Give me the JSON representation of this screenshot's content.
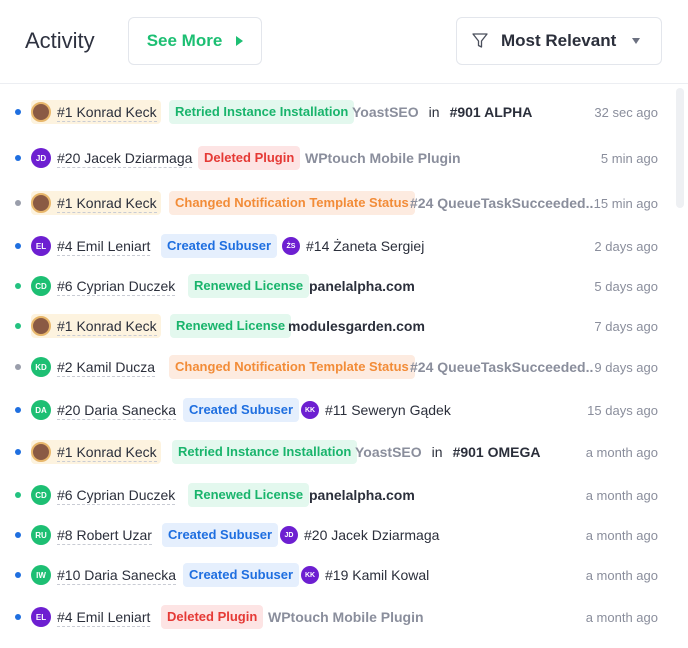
{
  "header": {
    "title": "Activity",
    "see_more": "See More",
    "filter_label": "Most Relevant"
  },
  "rows": [
    {
      "dot": "blue",
      "avatar": "",
      "user": "#1 Konrad Keck",
      "action": "Retried Instance Installation",
      "badge": "green",
      "target": "YoastSEO",
      "in": "in",
      "target2": "#901 ALPHA",
      "time": "32 sec ago"
    },
    {
      "dot": "blue",
      "avatar": "JD",
      "user": "#20 Jacek Dziarmaga",
      "action": "Deleted Plugin",
      "badge": "red",
      "target": "WPtouch Mobile Plugin",
      "time": "5 min ago"
    },
    {
      "dot": "gray",
      "avatar": "",
      "user": "#1 Konrad Keck",
      "action": "Changed Notification Template Status",
      "badge": "orange",
      "target": "#24 QueueTaskSucceeded..",
      "time": "15 min ago"
    },
    {
      "dot": "blue",
      "avatar": "EL",
      "user": "#4 Emil Leniart",
      "action": "Created Subuser",
      "badge": "blue",
      "sub_avatar": "ŻS",
      "sub_user": "#14 Żaneta Sergiej",
      "time": "2 days ago"
    },
    {
      "dot": "green",
      "avatar": "CD",
      "user": "#6 Cyprian Duczek",
      "action": "Renewed License",
      "badge": "green",
      "target": "panelalpha.com",
      "time": "5 days ago"
    },
    {
      "dot": "green",
      "avatar": "",
      "user": "#1 Konrad Keck",
      "action": "Renewed License",
      "badge": "green",
      "target": "modulesgarden.com",
      "time": "7 days ago"
    },
    {
      "dot": "gray",
      "avatar": "KD",
      "user": "#2 Kamil Ducza",
      "action": "Changed Notification Template Status",
      "badge": "orange",
      "target": "#24 QueueTaskSucceeded..",
      "time": "9 days ago"
    },
    {
      "dot": "blue",
      "avatar": "DA",
      "user": "#20 Daria Sanecka",
      "action": "Created Subuser",
      "badge": "blue",
      "sub_avatar": "KK",
      "sub_user": "#11 Seweryn Gądek",
      "time": "15 days ago"
    },
    {
      "dot": "blue",
      "avatar": "",
      "user": "#1 Konrad Keck",
      "action": "Retried Instance Installation",
      "badge": "green",
      "target": "YoastSEO",
      "in": "in",
      "target2": "#901 OMEGA",
      "time": "a month ago"
    },
    {
      "dot": "green",
      "avatar": "CD",
      "user": "#6 Cyprian Duczek",
      "action": "Renewed License",
      "badge": "green",
      "target": "panelalpha.com",
      "time": "a month ago"
    },
    {
      "dot": "blue",
      "avatar": "RU",
      "user": "#8 Robert Uzar",
      "action": "Created Subuser",
      "badge": "blue",
      "sub_avatar": "JD",
      "sub_user": "#20 Jacek Dziarmaga",
      "time": "a month ago"
    },
    {
      "dot": "blue",
      "avatar": "IW",
      "user": "#10 Daria Sanecka",
      "action": "Created Subuser",
      "badge": "blue",
      "sub_avatar": "KK",
      "sub_user": "#19 Kamil Kowal",
      "time": "a month ago"
    },
    {
      "dot": "blue",
      "avatar": "EL",
      "user": "#4 Emil Leniart",
      "action": "Deleted Plugin",
      "badge": "red",
      "target": "WPtouch Mobile Plugin",
      "time": "a month ago"
    }
  ]
}
